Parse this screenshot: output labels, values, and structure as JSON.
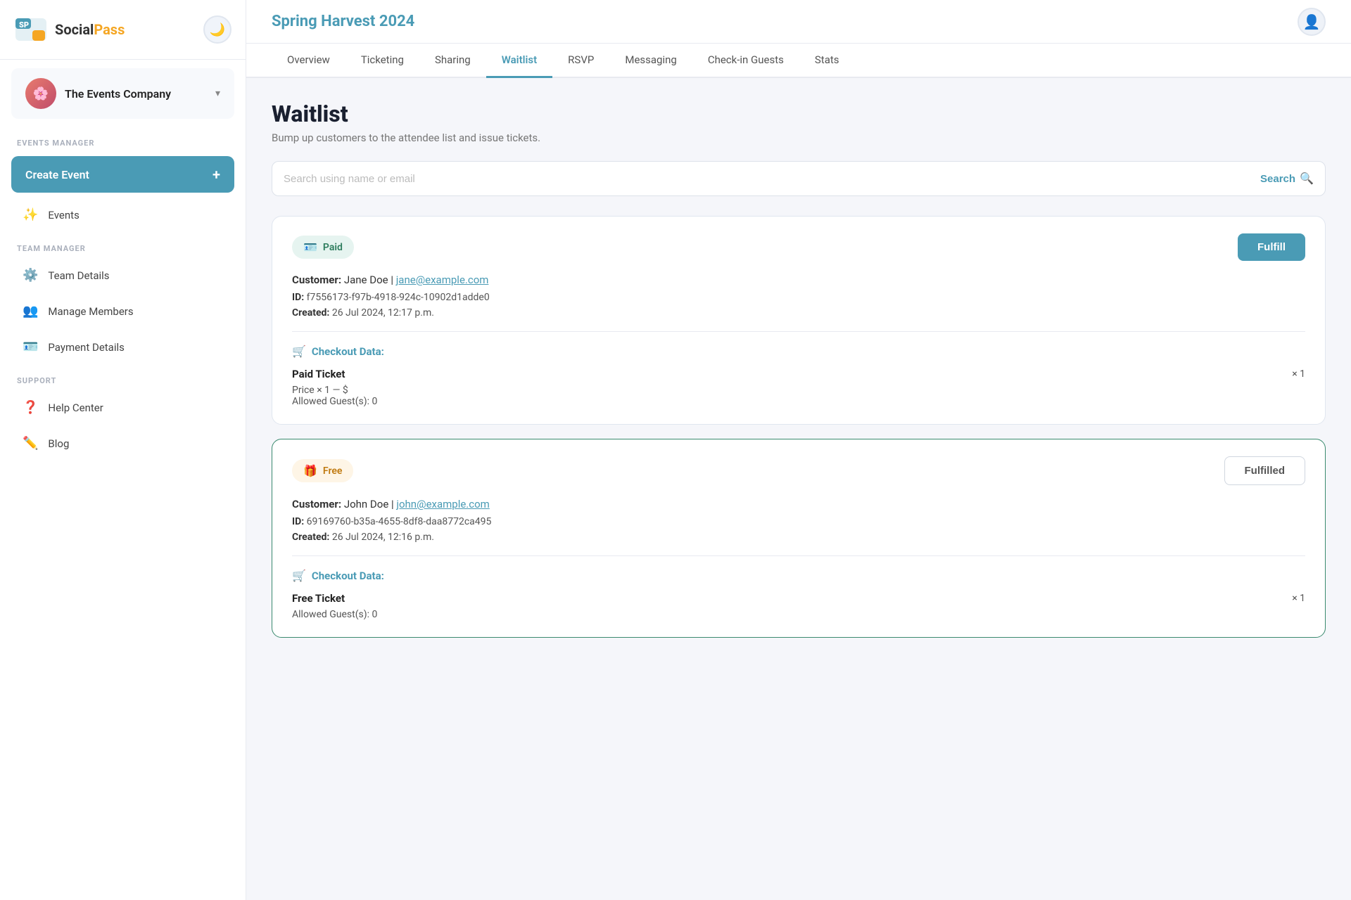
{
  "app": {
    "logo_text_social": "Social",
    "logo_text_pass": "Pass",
    "dark_toggle_icon": "🌙"
  },
  "sidebar": {
    "company": {
      "name": "The Events Company",
      "avatar_emoji": "🌸"
    },
    "sections": [
      {
        "label": "EVENTS MANAGER",
        "items": [
          {
            "id": "create-event",
            "label": "Create Event",
            "type": "button"
          },
          {
            "id": "events",
            "label": "Events",
            "icon": "✨"
          }
        ]
      },
      {
        "label": "TEAM MANAGER",
        "items": [
          {
            "id": "team-details",
            "label": "Team Details",
            "icon": "⚙️"
          },
          {
            "id": "manage-members",
            "label": "Manage Members",
            "icon": "👥"
          },
          {
            "id": "payment-details",
            "label": "Payment Details",
            "icon": "🪪"
          }
        ]
      },
      {
        "label": "SUPPORT",
        "items": [
          {
            "id": "help-center",
            "label": "Help Center",
            "icon": "❓"
          },
          {
            "id": "blog",
            "label": "Blog",
            "icon": "✏️"
          }
        ]
      }
    ]
  },
  "header": {
    "event_title": "Spring Harvest 2024"
  },
  "tabs": [
    {
      "id": "overview",
      "label": "Overview",
      "active": false
    },
    {
      "id": "ticketing",
      "label": "Ticketing",
      "active": false
    },
    {
      "id": "sharing",
      "label": "Sharing",
      "active": false
    },
    {
      "id": "waitlist",
      "label": "Waitlist",
      "active": true
    },
    {
      "id": "rsvp",
      "label": "RSVP",
      "active": false
    },
    {
      "id": "messaging",
      "label": "Messaging",
      "active": false
    },
    {
      "id": "check-in-guests",
      "label": "Check-in Guests",
      "active": false
    },
    {
      "id": "stats",
      "label": "Stats",
      "active": false
    }
  ],
  "waitlist": {
    "title": "Waitlist",
    "subtitle": "Bump up customers to the attendee list and issue tickets.",
    "search_placeholder": "Search using name or email",
    "search_label": "Search",
    "cards": [
      {
        "id": "card-1",
        "badge_type": "paid",
        "badge_label": "Paid",
        "badge_icon": "🪪",
        "action_label": "Fulfill",
        "action_type": "fulfill",
        "customer_name": "Jane Doe",
        "customer_email": "jane@example.com",
        "record_id": "f7556173-f97b-4918-924c-10902d1adde0",
        "created": "26 Jul 2024, 12:17 p.m.",
        "checkout_label": "Checkout Data:",
        "ticket_name": "Paid Ticket",
        "ticket_qty": "× 1",
        "ticket_price": "Price × 1 — $",
        "ticket_guests": "Allowed Guest(s): 0"
      },
      {
        "id": "card-2",
        "badge_type": "free",
        "badge_label": "Free",
        "badge_icon": "🎁",
        "action_label": "Fulfilled",
        "action_type": "fulfilled",
        "customer_name": "John Doe",
        "customer_email": "john@example.com",
        "record_id": "69169760-b35a-4655-8df8-daa8772ca495",
        "created": "26 Jul 2024, 12:16 p.m.",
        "checkout_label": "Checkout Data:",
        "ticket_name": "Free Ticket",
        "ticket_qty": "× 1",
        "ticket_price": "",
        "ticket_guests": "Allowed Guest(s): 0"
      }
    ]
  },
  "labels": {
    "customer": "Customer:",
    "id": "ID:",
    "created": "Created:",
    "pipe": " | "
  }
}
